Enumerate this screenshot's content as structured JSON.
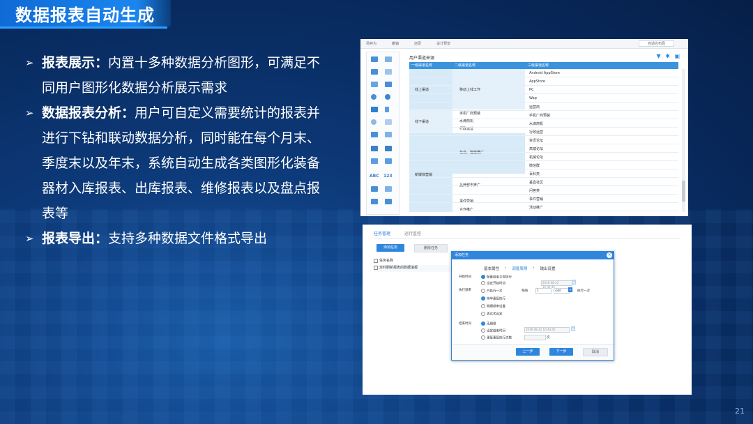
{
  "title": "数据报表自动生成",
  "bullets": [
    {
      "head": "报表展示：",
      "body": "内置十多种数据分析图形，可满足不同用户图形化数据分析展示需求"
    },
    {
      "head": "数据报表分析：",
      "body": "用户可自定义需要统计的报表并进行下钻和联动数据分析，同时能在每个月末、季度末以及年末，系统自动生成各类图形化装备器材入库报表、出库报表、维修报表以及盘点报表等"
    },
    {
      "head": "报表导出：",
      "body": "支持多种数据文件格式导出"
    }
  ],
  "page_number": "21",
  "report_designer": {
    "toolbar": [
      "另存为",
      "撤销",
      "还原",
      "设计预览"
    ],
    "toolbar_right": "自适应布局",
    "grid_title": "用户渠道来源",
    "columns": [
      "一级渠道名称",
      "二级渠道名称",
      "三级渠道名称"
    ],
    "level1": [
      "线上渠道",
      "线下渠道",
      "新媒体营销"
    ],
    "level2": [
      "移动上线工作",
      "手机厂商预装",
      "水滴商机",
      "行政运营",
      "社会、智能推广",
      "品牌都市推广",
      "事件营销",
      "合作推广"
    ],
    "level3": [
      "Android AppStore",
      "AppStore",
      "PC",
      "Wap",
      "运营商",
      "手机厂商预装",
      "水滴商机",
      "行政运营",
      "资讯论坛",
      "高端论坛",
      "机械论坛",
      "微信群",
      "百科类",
      "垂直社区",
      "问答类",
      "事件营销",
      "活动推广"
    ],
    "palette_labels": [
      "ABC",
      "123"
    ]
  },
  "task_manager": {
    "tabs": [
      "任务管理",
      "运行监控"
    ],
    "add_button": "添加任务",
    "delete_button": "删除任务",
    "list_header": "任务名称",
    "list_row": "定时刷新报表的数据填报",
    "dialog": {
      "title": "添加任务",
      "steps": [
        "基本属性",
        "调度周期",
        "输出设置"
      ],
      "start_label": "开始时间",
      "start_options": [
        "配置结束立即执行",
        "设定开始时间"
      ],
      "start_value": "2016-08-22 16:44:45",
      "freq_label": "执行频率",
      "freq_options": [
        "只执行一次",
        "简单重复执行",
        "明细频率设置",
        "表达式设定"
      ],
      "every_label": "每隔",
      "every_value": "1",
      "unit_value": "小时",
      "every_suffix": "执行一次",
      "end_label": "结束时间",
      "end_options": [
        "无期限",
        "设定结束时间",
        "重复重复执行次数"
      ],
      "end_value": "2016-08-22 16:44:45",
      "times_suffix": "次",
      "prev_button": "上一步",
      "next_button": "下一步",
      "cancel_button": "取消"
    }
  }
}
